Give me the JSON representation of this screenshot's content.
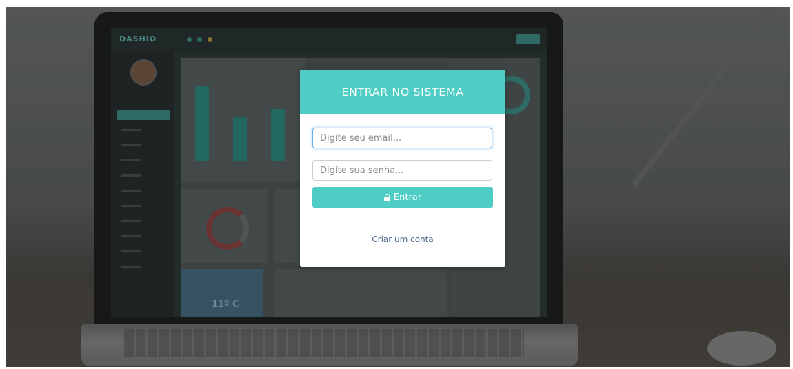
{
  "background": {
    "dashboard_logo": "DASH",
    "dashboard_logo_accent": "IO",
    "weather_temp": "11º C"
  },
  "modal": {
    "title": "ENTRAR NO SISTEMA",
    "email_placeholder": "Digite seu email...",
    "password_placeholder": "Digite sua senha...",
    "login_label": "Entrar",
    "create_account_label": "Criar um conta"
  },
  "colors": {
    "accent": "#4ecdc4",
    "link": "#4d6a8e",
    "focus": "#66afe9"
  },
  "icons": {
    "login_button_icon": "lock-icon"
  }
}
